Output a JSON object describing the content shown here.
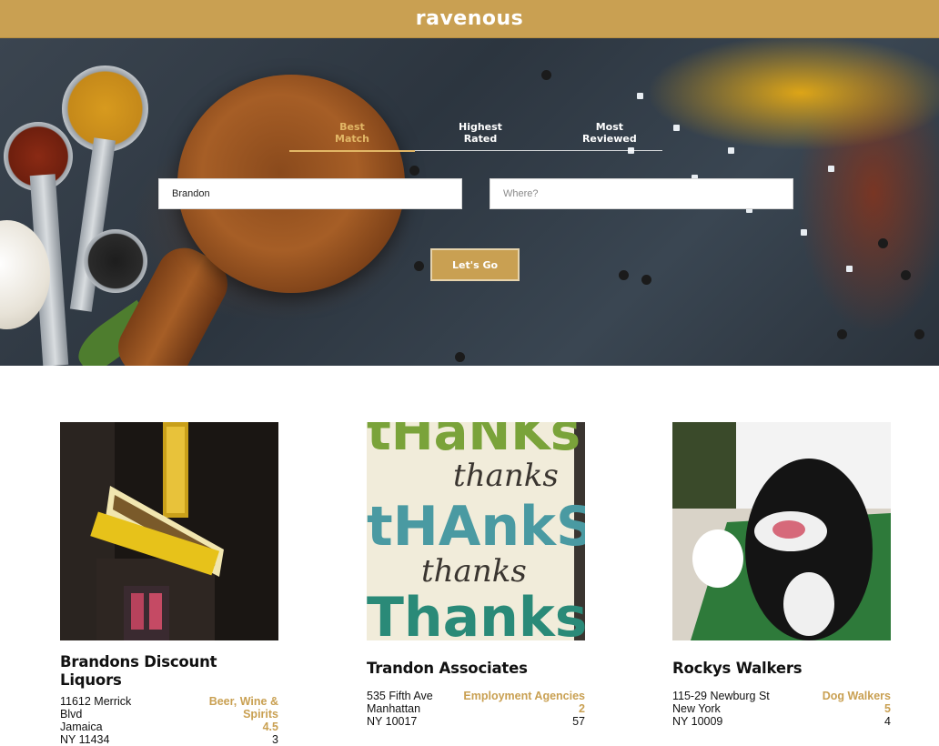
{
  "header": {
    "logo": "ravenous"
  },
  "sort_tabs": [
    {
      "label": "Best Match",
      "active": true
    },
    {
      "label": "Highest Rated",
      "active": false
    },
    {
      "label": "Most Reviewed",
      "active": false
    }
  ],
  "search": {
    "term_value": "Brandon",
    "location_value": "",
    "location_placeholder": "Where?",
    "button_label": "Let's Go"
  },
  "colors": {
    "accent": "#c9a052",
    "white": "#ffffff",
    "text": "#111111"
  },
  "businesses": [
    {
      "name": "Brandons Discount Liquors",
      "address_lines": [
        "11612 Merrick",
        "Blvd",
        "Jamaica",
        "NY 11434"
      ],
      "category": "Beer, Wine & Spirits",
      "rating": "4.5",
      "review_count": "3"
    },
    {
      "name": "Trandon Associates",
      "address_lines": [
        "535 Fifth Ave",
        "Manhattan",
        "NY 10017"
      ],
      "category": "Employment Agencies",
      "rating": "2",
      "review_count": "57"
    },
    {
      "name": "Rockys Walkers",
      "address_lines": [
        "115-29 Newburg St",
        "New York",
        "NY 10009"
      ],
      "category": "Dog Walkers",
      "rating": "5",
      "review_count": "4"
    }
  ]
}
